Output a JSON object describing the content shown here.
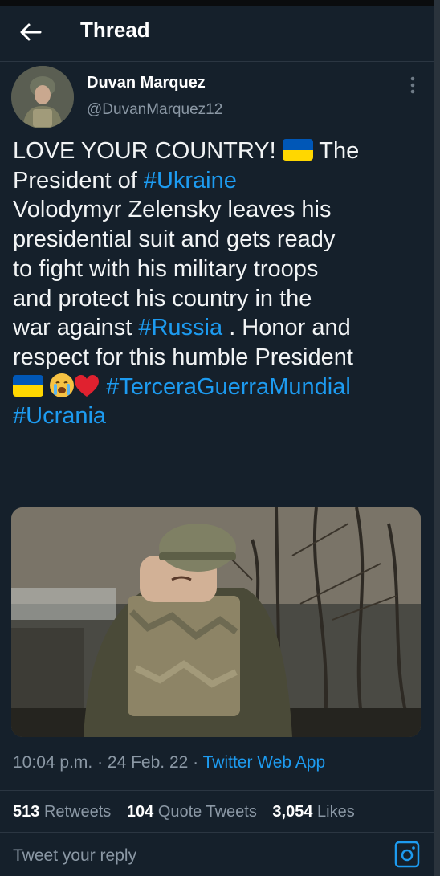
{
  "header": {
    "back_icon": "arrow-left-icon",
    "title": "Thread"
  },
  "author": {
    "name": "Duvan Marquez",
    "handle": "@DuvanMarquez12",
    "more_icon": "more-vertical-icon"
  },
  "tweet": {
    "text_1": "LOVE YOUR COUNTRY! ",
    "text_2": " The\nPresident of ",
    "hashtag_ukraine": "#Ukraine",
    "text_3": "\nVolodymyr Zelensky leaves his\npresidential suit and gets ready\nto fight with his military troops\nand protect his country in the\nwar against ",
    "hashtag_russia": "#Russia",
    "text_4": " . Honor and\nrespect for this humble President\n",
    "hashtag_tercera": "#TerceraGuerraMundial",
    "hashtag_ucrania": "#Ucrania",
    "emojis": [
      "ukraine-flag-emoji",
      "crying-face-emoji",
      "red-heart-emoji"
    ]
  },
  "meta": {
    "time": "10:04 p.m.",
    "sep": " · ",
    "date": "24 Feb. 22",
    "app": "Twitter Web App"
  },
  "stats": {
    "retweets_count": "513",
    "retweets_label": "Retweets",
    "quotes_count": "104",
    "quotes_label": "Quote Tweets",
    "likes_count": "3,054",
    "likes_label": "Likes"
  },
  "reply": {
    "placeholder": "Tweet your reply",
    "camera_icon": "camera-icon"
  },
  "colors": {
    "background": "#15202b",
    "link": "#1d9bf0",
    "muted": "#8b98a5",
    "flag_blue": "#0057b7",
    "flag_yellow": "#ffd700"
  }
}
